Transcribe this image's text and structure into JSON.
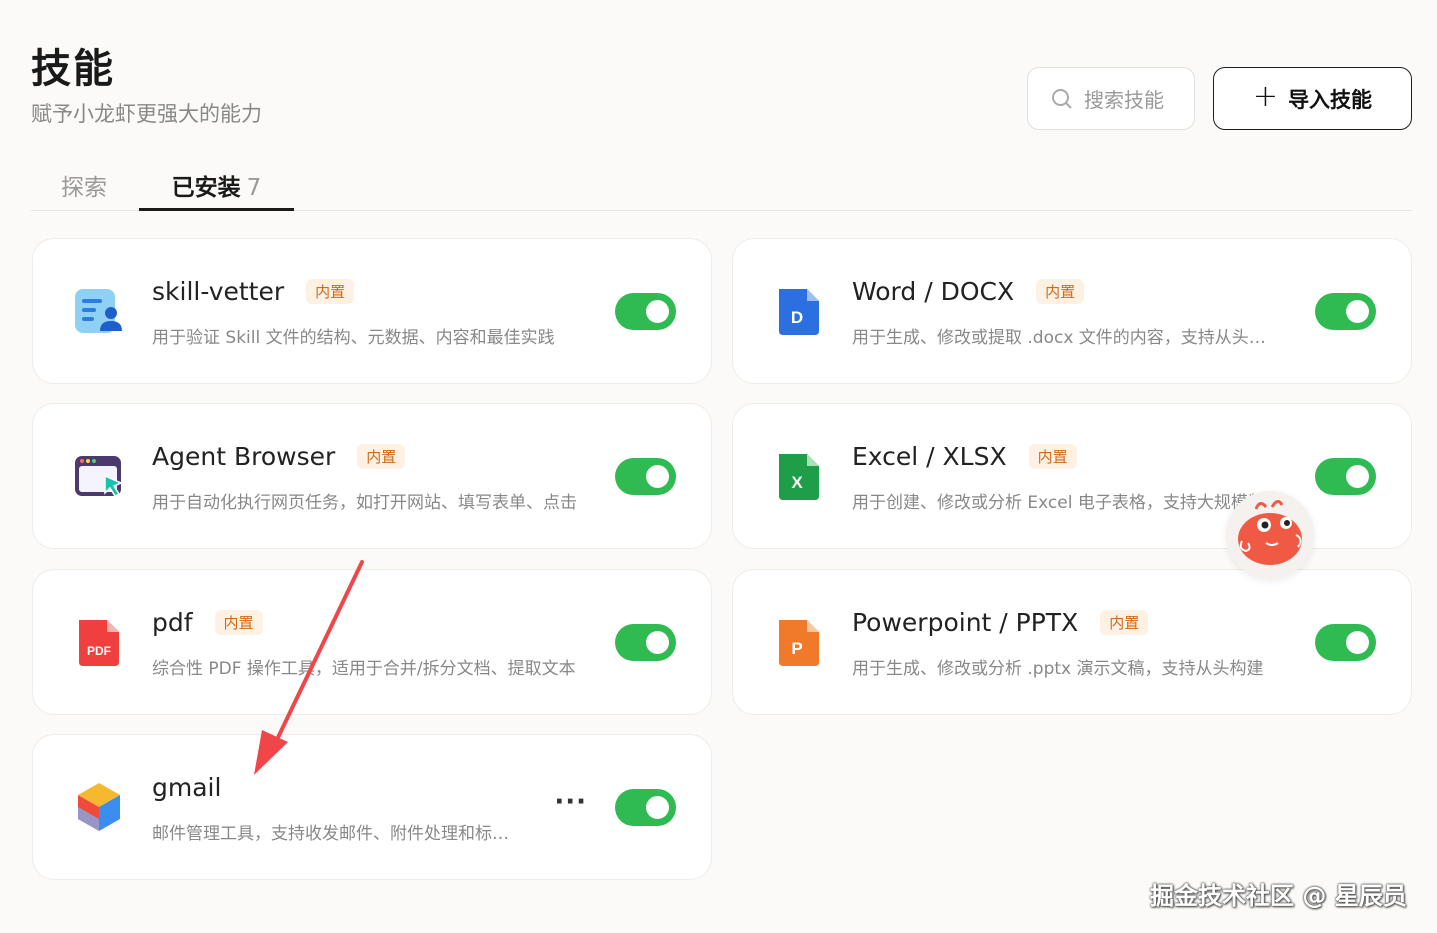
{
  "header": {
    "title": "技能",
    "subtitle": "赋予小龙虾更强大的能力",
    "search_placeholder": "搜索技能",
    "import_label": "导入技能"
  },
  "tabs": {
    "explore": "探索",
    "installed": "已安装",
    "installed_count": "7"
  },
  "skills": [
    {
      "name": "skill-vetter",
      "badge": "内置",
      "desc": "用于验证 Skill 文件的结构、元数据、内容和最佳实践",
      "enabled": true,
      "icon": "vetter-icon"
    },
    {
      "name": "Word / DOCX",
      "badge": "内置",
      "desc": "用于生成、修改或提取 .docx 文件的内容，支持从头构建",
      "enabled": true,
      "icon": "word-icon"
    },
    {
      "name": "Agent Browser",
      "badge": "内置",
      "desc": "用于自动化执行网页任务，如打开网站、填写表单、点击",
      "enabled": true,
      "icon": "browser-icon"
    },
    {
      "name": "Excel / XLSX",
      "badge": "内置",
      "desc": "用于创建、修改或分析 Excel 电子表格，支持大规模数据",
      "enabled": true,
      "icon": "excel-icon"
    },
    {
      "name": "pdf",
      "badge": "内置",
      "desc": "综合性 PDF 操作工具，适用于合并/拆分文档、提取文本",
      "enabled": true,
      "icon": "pdf-icon"
    },
    {
      "name": "Powerpoint / PPTX",
      "badge": "内置",
      "desc": "用于生成、修改或分析 .pptx 演示文稿，支持从头构建",
      "enabled": true,
      "icon": "ppt-icon"
    },
    {
      "name": "gmail",
      "badge": "",
      "desc": "邮件管理工具，支持收发邮件、附件处理和标签管理",
      "enabled": true,
      "icon": "gmail-icon"
    }
  ],
  "icon_labels": {
    "word": "D",
    "excel": "X",
    "pdf": "PDF",
    "ppt": "P"
  },
  "more_label": "···",
  "watermark": "掘金技术社区 @ 星辰员",
  "colors": {
    "toggle_on": "#2fba52",
    "badge_text": "#d06a1a",
    "badge_bg": "#fdf1e4",
    "annotation_arrow": "#f0464a"
  }
}
